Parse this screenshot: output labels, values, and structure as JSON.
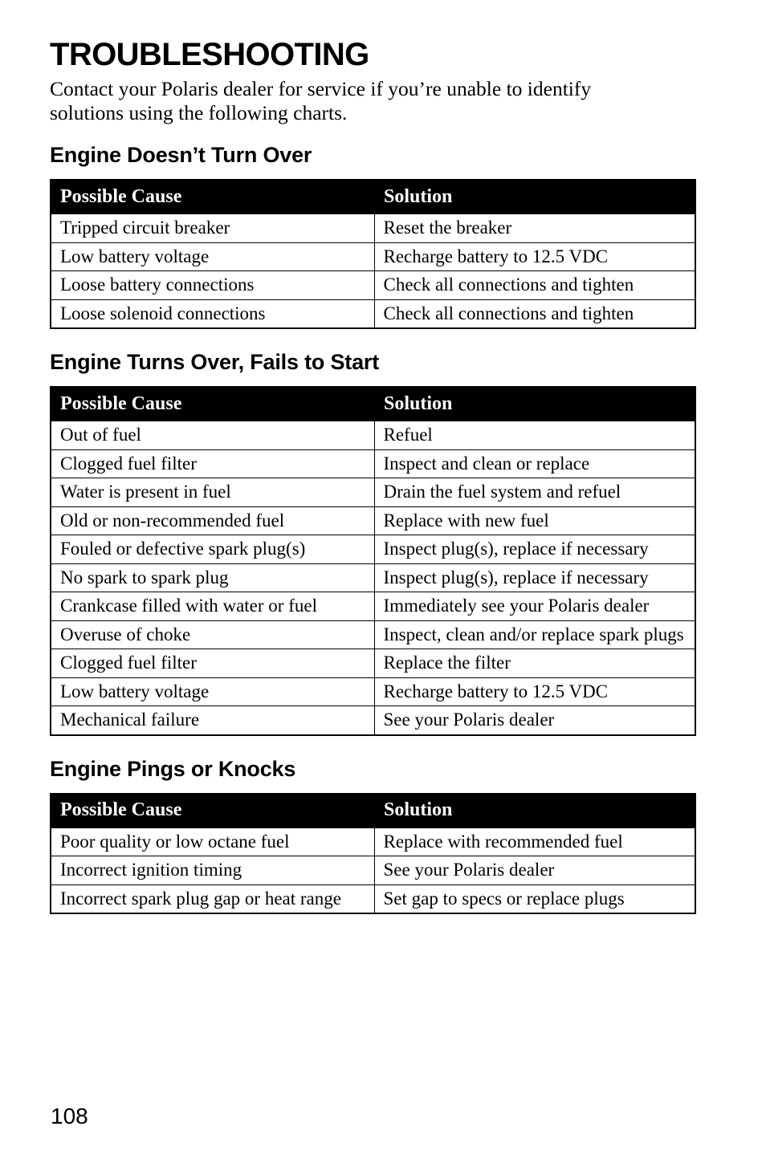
{
  "document": {
    "title": "TROUBLESHOOTING",
    "intro": "Contact your Polaris dealer for service if you’re unable to identify solutions using the following charts.",
    "page_number": "108"
  },
  "table_columns": {
    "cause": "Possible Cause",
    "solution": "Solution"
  },
  "sections": [
    {
      "heading": "Engine Doesn’t Turn Over",
      "rows": [
        {
          "cause": "Tripped circuit breaker",
          "solution": "Reset the breaker"
        },
        {
          "cause": "Low battery voltage",
          "solution": "Recharge battery to 12.5 VDC"
        },
        {
          "cause": "Loose battery connections",
          "solution": "Check all connections and tighten"
        },
        {
          "cause": "Loose solenoid connections",
          "solution": "Check all connections and tighten"
        }
      ]
    },
    {
      "heading": "Engine Turns Over, Fails to Start",
      "rows": [
        {
          "cause": "Out of fuel",
          "solution": "Refuel"
        },
        {
          "cause": "Clogged fuel filter",
          "solution": "Inspect and clean or replace"
        },
        {
          "cause": "Water is present in fuel",
          "solution": "Drain the fuel system and refuel"
        },
        {
          "cause": "Old or non-recommended fuel",
          "solution": "Replace with new fuel"
        },
        {
          "cause": "Fouled or defective spark plug(s)",
          "solution": "Inspect plug(s), replace if necessary"
        },
        {
          "cause": "No spark to spark plug",
          "solution": "Inspect plug(s), replace if necessary"
        },
        {
          "cause": "Crankcase filled with water or fuel",
          "solution": "Immediately see your Polaris dealer"
        },
        {
          "cause": "Overuse of choke",
          "solution": "Inspect, clean and/or replace spark plugs"
        },
        {
          "cause": "Clogged fuel filter",
          "solution": "Replace the filter"
        },
        {
          "cause": "Low battery voltage",
          "solution": "Recharge battery to 12.5 VDC"
        },
        {
          "cause": "Mechanical failure",
          "solution": "See your Polaris dealer"
        }
      ]
    },
    {
      "heading": "Engine Pings or Knocks",
      "rows": [
        {
          "cause": "Poor quality or low octane fuel",
          "solution": "Replace with recommended fuel"
        },
        {
          "cause": "Incorrect ignition timing",
          "solution": "See your Polaris dealer"
        },
        {
          "cause": "Incorrect spark plug gap or heat range",
          "solution": "Set gap to specs or replace plugs"
        }
      ]
    }
  ],
  "colors": {
    "header_background": "#000000",
    "header_text": "#ffffff",
    "body_text": "#000000",
    "page_background": "#ffffff"
  }
}
